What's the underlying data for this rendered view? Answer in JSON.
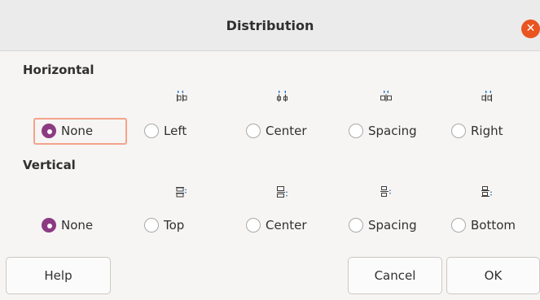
{
  "window": {
    "title": "Distribution",
    "close_icon": "close-icon"
  },
  "horizontal": {
    "label": "Horizontal",
    "options": [
      {
        "label": "None",
        "checked": true,
        "icon": null
      },
      {
        "label": "Left",
        "checked": false,
        "icon": "distribute-left-icon"
      },
      {
        "label": "Center",
        "checked": false,
        "icon": "distribute-center-horizontal-icon"
      },
      {
        "label": "Spacing",
        "checked": false,
        "icon": "distribute-spacing-horizontal-icon"
      },
      {
        "label": "Right",
        "checked": false,
        "icon": "distribute-right-icon"
      }
    ]
  },
  "vertical": {
    "label": "Vertical",
    "options": [
      {
        "label": "None",
        "checked": true,
        "icon": null
      },
      {
        "label": "Top",
        "checked": false,
        "icon": "distribute-top-icon"
      },
      {
        "label": "Center",
        "checked": false,
        "icon": "distribute-center-vertical-icon"
      },
      {
        "label": "Spacing",
        "checked": false,
        "icon": "distribute-spacing-vertical-icon"
      },
      {
        "label": "Bottom",
        "checked": false,
        "icon": "distribute-bottom-icon"
      }
    ]
  },
  "buttons": {
    "help": "Help",
    "cancel": "Cancel",
    "ok": "OK"
  },
  "colors": {
    "accent": "#8c3b82",
    "close": "#e95420",
    "focus": "#f5a28a",
    "icon_blue": "#1e6fb8"
  }
}
